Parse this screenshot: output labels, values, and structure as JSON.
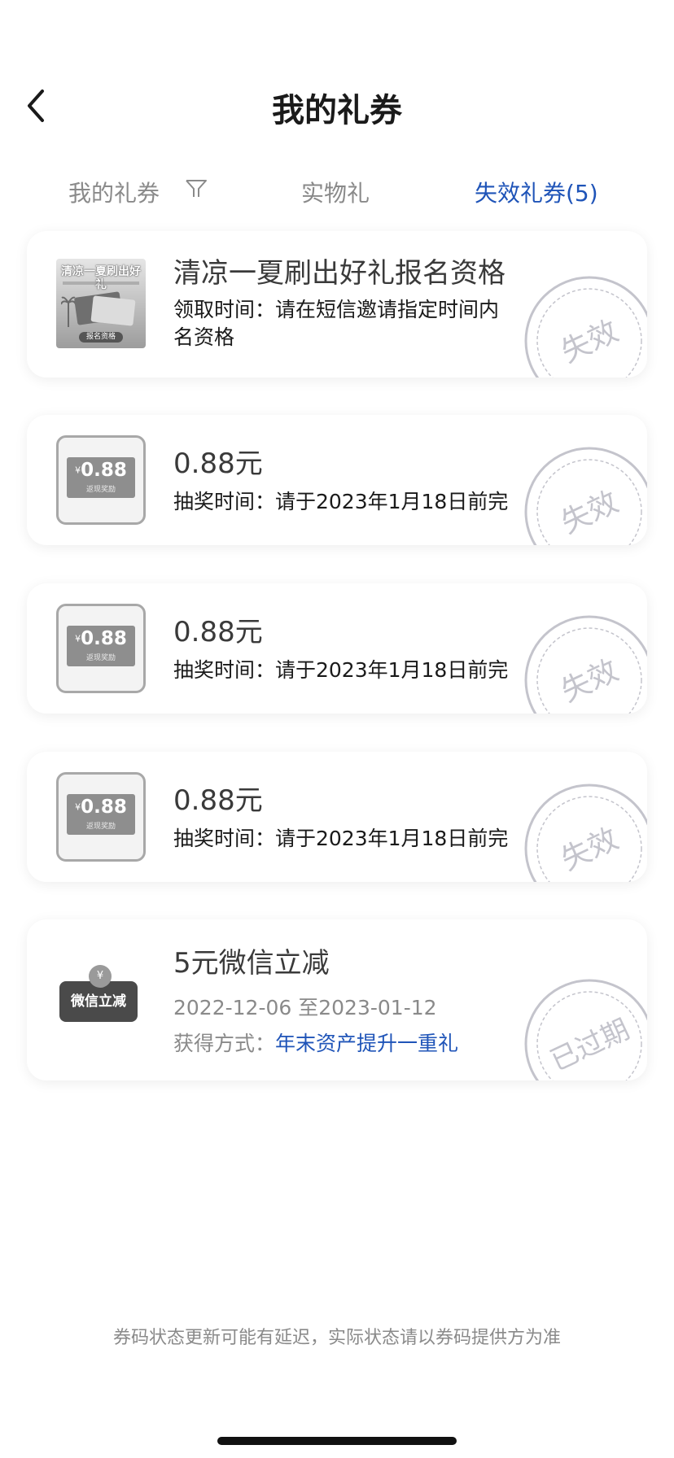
{
  "header": {
    "title": "我的礼券"
  },
  "tabs": [
    {
      "label": "我的礼券"
    },
    {
      "label": "实物礼"
    },
    {
      "label": "失效礼券(5)"
    }
  ],
  "cards": [
    {
      "thumb_title": "清凉一夏刷出好礼",
      "thumb_button": "报名资格",
      "title": "清凉一夏刷出好礼报名资格",
      "line1": "领取时间：请在短信邀请指定时间内",
      "line2": "名资格",
      "stamp": "失效"
    },
    {
      "thumb_yen": "¥",
      "thumb_amount": "0.88",
      "thumb_sub": "返现奖励",
      "title": "0.88元",
      "line1": "抽奖时间：请于2023年1月18日前完",
      "stamp": "失效"
    },
    {
      "thumb_yen": "¥",
      "thumb_amount": "0.88",
      "thumb_sub": "返现奖励",
      "title": "0.88元",
      "line1": "抽奖时间：请于2023年1月18日前完",
      "stamp": "失效"
    },
    {
      "thumb_yen": "¥",
      "thumb_amount": "0.88",
      "thumb_sub": "返现奖励",
      "title": "0.88元",
      "line1": "抽奖时间：请于2023年1月18日前完",
      "stamp": "失效"
    },
    {
      "thumb_coin": "¥",
      "thumb_label": "微信立减",
      "title": "5元微信立减",
      "date_range": "2022-12-06 至2023-01-12",
      "method_label": "获得方式：",
      "method_link": "年末资产提升一重礼",
      "stamp": "已过期"
    }
  ],
  "footer": {
    "note": "券码状态更新可能有延迟，实际状态请以券码提供方为准"
  },
  "colors": {
    "accent_blue": "#1f54b8",
    "tab_inactive": "#8a8a8a",
    "stamp_gray": "#c4c4cc"
  }
}
